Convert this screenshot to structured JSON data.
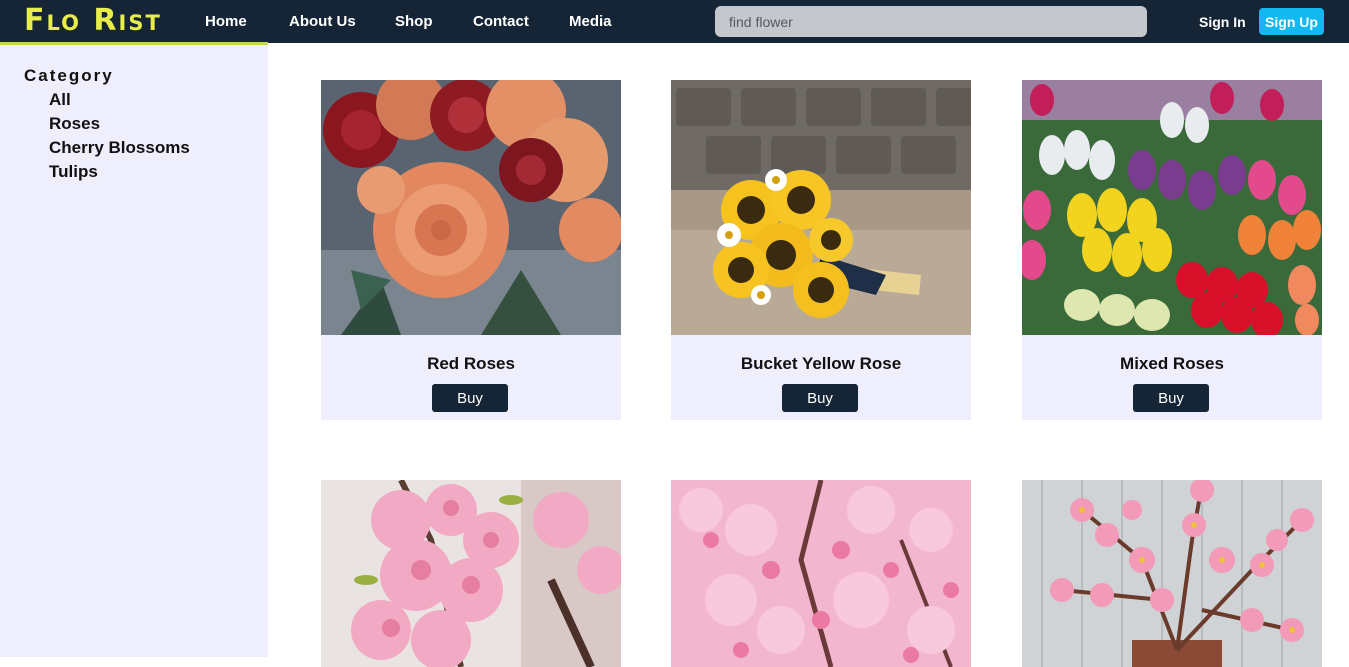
{
  "brand": {
    "logo": "Flo Rist",
    "logo_color": "#e7ee4a",
    "header_bg": "#152536"
  },
  "nav": {
    "home": "Home",
    "about": "About Us",
    "shop": "Shop",
    "contact": "Contact",
    "media": "Media"
  },
  "search": {
    "placeholder": "find flower",
    "value": ""
  },
  "auth": {
    "signin": "Sign In",
    "signup": "Sign Up",
    "signup_color": "#12b8f0"
  },
  "sidebar": {
    "title": "Category",
    "items": [
      {
        "label": "All"
      },
      {
        "label": "Roses"
      },
      {
        "label": "Cherry Blossoms"
      },
      {
        "label": "Tulips"
      }
    ]
  },
  "products": [
    {
      "name": "Red Roses",
      "buy_label": "Buy",
      "image": "roses-bouquet-photo"
    },
    {
      "name": "Bucket Yellow Rose",
      "buy_label": "Buy",
      "image": "sunflower-bouquet-photo"
    },
    {
      "name": "Mixed Roses",
      "buy_label": "Buy",
      "image": "tulip-market-photo"
    },
    {
      "name": "",
      "buy_label": "",
      "image": "cherry-blossom-photo"
    },
    {
      "name": "",
      "buy_label": "",
      "image": "cherry-blossom-photo"
    },
    {
      "name": "",
      "buy_label": "",
      "image": "cherry-blossom-vase-photo"
    }
  ]
}
